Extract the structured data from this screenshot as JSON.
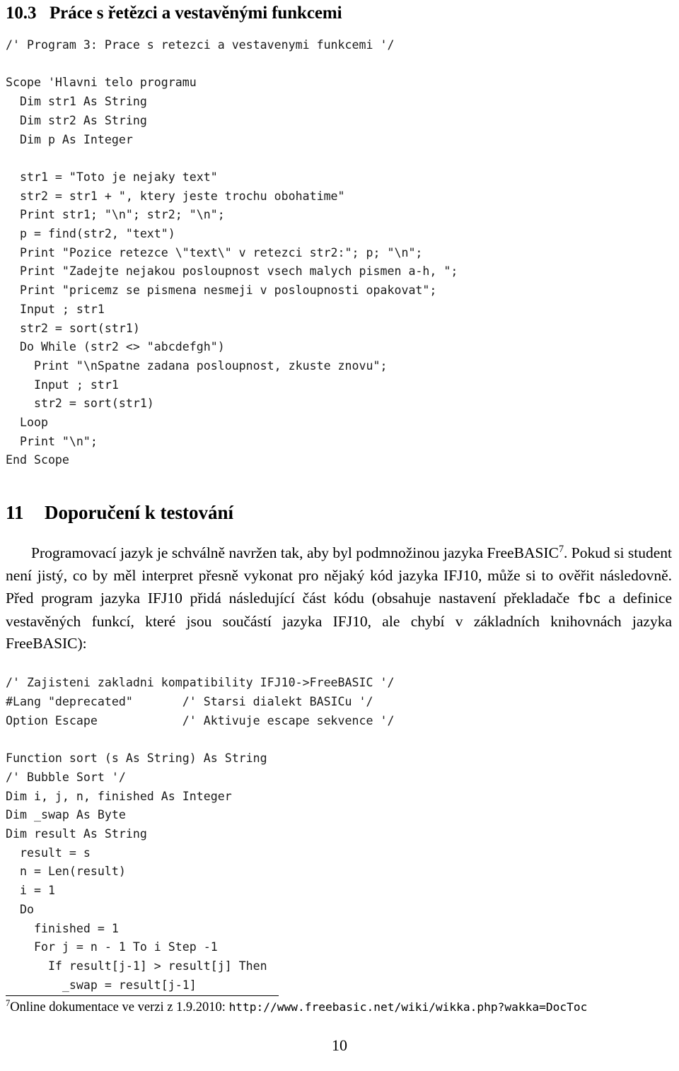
{
  "document": {
    "language": "cs",
    "page_number": "10"
  },
  "section_10_3": {
    "number": "10.3",
    "title": "Práce s řetězci a vestavěnými funkcemi"
  },
  "code_block_1": {
    "name": "program-3-string-functions",
    "lines": "/' Program 3: Prace s retezci a vestavenymi funkcemi '/\n\nScope 'Hlavni telo programu\n  Dim str1 As String\n  Dim str2 As String\n  Dim p As Integer\n\n  str1 = \"Toto je nejaky text\"\n  str2 = str1 + \", ktery jeste trochu obohatime\"\n  Print str1; \"\\n\"; str2; \"\\n\";\n  p = find(str2, \"text\")\n  Print \"Pozice retezce \\\"text\\\" v retezci str2:\"; p; \"\\n\";\n  Print \"Zadejte nejakou posloupnost vsech malych pismen a-h, \";\n  Print \"pricemz se pismena nesmeji v posloupnosti opakovat\";\n  Input ; str1\n  str2 = sort(str1)\n  Do While (str2 <> \"abcdefgh\")\n    Print \"\\nSpatne zadana posloupnost, zkuste znovu\";\n    Input ; str1\n    str2 = sort(str1)\n  Loop\n  Print \"\\n\";\nEnd Scope"
  },
  "section_11": {
    "number": "11",
    "title": "Doporučení k testování"
  },
  "paragraph_1": {
    "part_1": "Programovací jazyk je schválně navržen tak, aby byl podmnožinou jazyka FreeBASIC",
    "footnote_marker": "7",
    "part_2": ". Pokud si student není jistý, co by měl interpret přesně vykonat pro nějaký kód jazyka IFJ10, může si to ověřit následovně. Před program jazyka IFJ10 přidá následující část kódu (obsahuje nastavení překladače ",
    "inline_code": "fbc",
    "part_3": " a definice vestavěných funkcí, které jsou součástí jazyka IFJ10, ale chybí v základních knihovnách jazyka FreeBASIC):"
  },
  "code_block_2": {
    "name": "ifj10-freebasic-compatibility-header",
    "lines": "/' Zajisteni zakladni kompatibility IFJ10->FreeBASIC '/\n#Lang \"deprecated\"       /' Starsi dialekt BASICu '/\nOption Escape            /' Aktivuje escape sekvence '/"
  },
  "code_block_3": {
    "name": "sort-function-bubble-sort",
    "lines": "Function sort (s As String) As String\n/' Bubble Sort '/\nDim i, j, n, finished As Integer\nDim _swap As Byte\nDim result As String\n  result = s\n  n = Len(result)\n  i = 1\n  Do\n    finished = 1\n    For j = n - 1 To i Step -1\n      If result[j-1] > result[j] Then\n        _swap = result[j-1]"
  },
  "footnote_7": {
    "marker": "7",
    "text": "Online dokumentace ve verzi z 1.9.2010: ",
    "url": "http://www.freebasic.net/wiki/wikka.php?wakka=DocToc"
  }
}
